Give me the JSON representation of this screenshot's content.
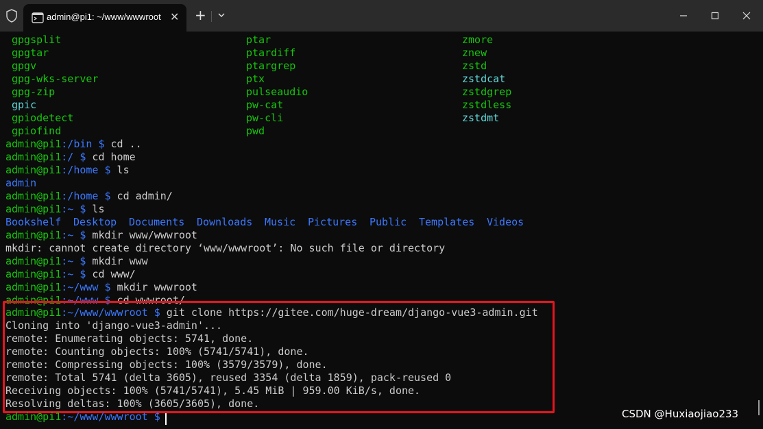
{
  "window": {
    "tab_title": "admin@pi1: ~/www/wwwroot",
    "tab_close": "✕",
    "new_tab": "+"
  },
  "colors": {
    "green": "#16c60c",
    "blue": "#3b78ff",
    "cyan": "#61d6d6",
    "text": "#cccccc",
    "highlight": "#e8141d"
  },
  "listing": {
    "col1": [
      "gpgsplit",
      "gpgtar",
      "gpgv",
      "gpg-wks-server",
      "gpg-zip",
      "gpic",
      "gpiodetect",
      "gpiofind"
    ],
    "col2": [
      "ptar",
      "ptardiff",
      "ptargrep",
      "ptx",
      "pulseaudio",
      "pw-cat",
      "pw-cli",
      "pwd"
    ],
    "col3": [
      "zmore",
      "znew",
      "zstd",
      "zstdcat",
      "zstdgrep",
      "zstdless",
      "zstdmt"
    ]
  },
  "session": {
    "user": "admin@pi1",
    "l1_path": ":/bin $",
    "l1_cmd": " cd ..",
    "l2_path": ":/ $",
    "l2_cmd": " cd home",
    "l3_path": ":/home $",
    "l3_cmd": " ls",
    "l4_out": "admin",
    "l5_path": ":/home $",
    "l5_cmd": " cd admin/",
    "l6_path": ":~ $",
    "l6_cmd": " ls",
    "dirs": [
      "Bookshelf",
      "Desktop",
      "Documents",
      "Downloads",
      "Music",
      "Pictures",
      "Public",
      "Templates",
      "Videos"
    ],
    "l8_path": ":~ $",
    "l8_cmd": " mkdir www/wwwroot",
    "l9_out": "mkdir: cannot create directory ‘www/wwwroot’: No such file or directory",
    "l10_path": ":~ $",
    "l10_cmd": " mkdir www",
    "l11_path": ":~ $",
    "l11_cmd": " cd www/",
    "l12_path": ":~/www $",
    "l12_cmd": " mkdir wwwroot",
    "l13_path": ":~/www $",
    "l13_cmd": " cd wwwroot/",
    "l14_path": ":~/www/wwwroot $",
    "l14_cmd": " git clone https://gitee.com/huge-dream/django-vue3-admin.git",
    "clone_output": [
      "Cloning into 'django-vue3-admin'...",
      "remote: Enumerating objects: 5741, done.",
      "remote: Counting objects: 100% (5741/5741), done.",
      "remote: Compressing objects: 100% (3579/3579), done.",
      "remote: Total 5741 (delta 3605), reused 3354 (delta 1859), pack-reused 0",
      "Receiving objects: 100% (5741/5741), 5.45 MiB | 959.00 KiB/s, done.",
      "Resolving deltas: 100% (3605/3605), done."
    ],
    "final_path": ":~/www/wwwroot $"
  },
  "watermark": "CSDN @Huxiaojiao233"
}
